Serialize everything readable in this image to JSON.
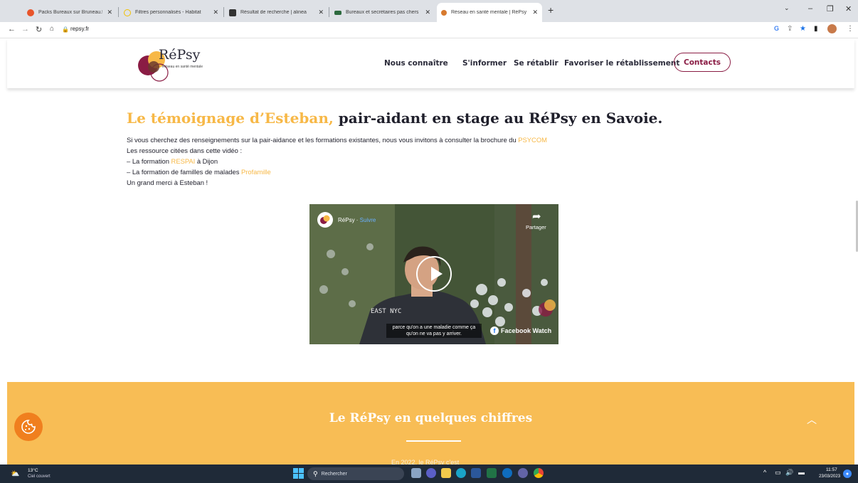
{
  "browser": {
    "tabs": [
      {
        "label": "Packs Bureaux sur Bruneau.fr",
        "color": "#e8542a"
      },
      {
        "label": "Filtres personnalisés - Habitat",
        "color": "#f2c100"
      },
      {
        "label": "Résultat de recherche | alinea",
        "color": "#333333"
      },
      {
        "label": "Bureaux et secrétaires pas chers",
        "color": "#2d6a3e"
      },
      {
        "label": "Réseau en santé mentale | RéPsy",
        "color": "#d77a2e",
        "active": true
      }
    ],
    "new_tab_symbol": "+",
    "url": "repsy.fr"
  },
  "site": {
    "logo_text": "RéPsy",
    "logo_tagline": "Réseau en santé mentale",
    "nav": [
      "Nous connaître",
      "S'informer",
      "Se rétablir",
      "Favoriser le rétablissement"
    ],
    "contacts_label": "Contacts"
  },
  "article": {
    "headline_highlight": "Le témoignage d’Esteban,",
    "headline_rest": " pair-aidant en stage au RéPsy en Savoie.",
    "line1_text": "Si vous cherchez des renseignements sur la pair-aidance et les formations existantes, nous vous invitons à consulter la brochure du ",
    "line1_link": "PSYCOM",
    "line2": "Les ressource citées dans cette vidéo :",
    "line3_pre": "– La formation ",
    "line3_link": "RESPAI",
    "line3_post": " à Dijon",
    "line4_pre": "– La formation de familles de malades ",
    "line4_link": "Profamille",
    "line5": "Un grand merci à Esteban !"
  },
  "video": {
    "channel": "RéPsy",
    "separator": " · ",
    "follow": "Suivre",
    "share_label": "Partager",
    "caption_line1": "parce qu'on a une maladie comme ça",
    "caption_line2": "qu'on ne va pas y arriver.",
    "watch_label": "Facebook Watch",
    "sweater_text": "EAST NYC"
  },
  "band": {
    "title": "Le RéPsy en quelques chiffres",
    "subtitle": "En 2022, le RéPsy c'est"
  },
  "taskbar": {
    "temperature": "13°C",
    "weather": "Ciel couvert",
    "search_placeholder": "Rechercher",
    "time": "11:57",
    "date": "23/03/2023"
  },
  "colors": {
    "accent_orange": "#f7b847",
    "band_yellow": "#f8bd55",
    "brand_bordeaux": "#8a1c44",
    "cookie_orange": "#f07f1e"
  }
}
